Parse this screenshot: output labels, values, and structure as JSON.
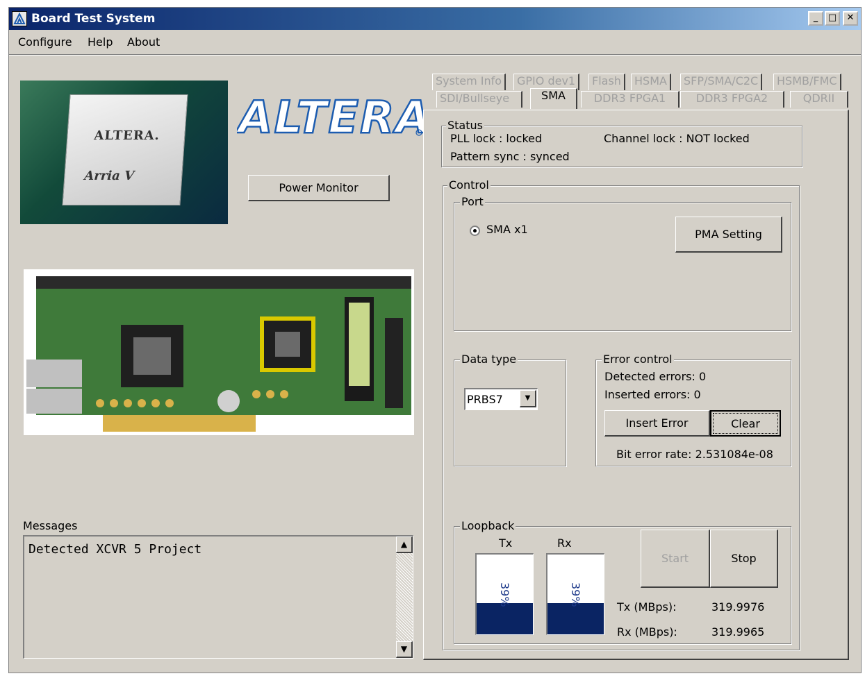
{
  "window": {
    "title": "Board Test System",
    "controls": {
      "minimize": "_",
      "maximize": "□",
      "close": "✕"
    }
  },
  "menu": {
    "items": [
      "Configure",
      "Help",
      "About"
    ]
  },
  "logo": {
    "brand": "ALTERA",
    "chip_brand": "ALTERA.",
    "chip_family": "Arria V"
  },
  "power_monitor_label": "Power Monitor",
  "messages": {
    "label": "Messages",
    "text": "Detected XCVR 5 Project"
  },
  "tabs": {
    "row1": [
      "System Info",
      "GPIO dev1",
      "Flash",
      "HSMA",
      "SFP/SMA/C2C",
      "HSMB/FMC"
    ],
    "row2": [
      "SDI/Bullseye",
      "SMA",
      "DDR3 FPGA1",
      "DDR3 FPGA2",
      "QDRII"
    ],
    "active": "SMA"
  },
  "status": {
    "title": "Status",
    "pll_lock": "PLL lock : locked",
    "channel_lock": "Channel lock : NOT locked",
    "pattern_sync": "Pattern sync : synced"
  },
  "control": {
    "title": "Control",
    "port": {
      "title": "Port",
      "option": "SMA x1",
      "selected": true,
      "pma_button": "PMA Setting"
    },
    "data_type": {
      "title": "Data type",
      "value": "PRBS7"
    },
    "error_control": {
      "title": "Error control",
      "detected": "Detected errors: 0",
      "inserted": "Inserted errors: 0",
      "insert_button": "Insert Error",
      "clear_button": "Clear",
      "bit_error_rate": "Bit error rate: 2.531084e-08"
    },
    "loopback": {
      "title": "Loopback",
      "tx_label": "Tx",
      "rx_label": "Rx",
      "tx_percent": 39,
      "rx_percent": 39,
      "tx_percent_text": "39%",
      "rx_percent_text": "39%",
      "start_button": "Start",
      "stop_button": "Stop",
      "tx_rate_label": "Tx (MBps):",
      "tx_rate_value": "319.9976",
      "rx_rate_label": "Rx (MBps):",
      "rx_rate_value": "319.9965"
    }
  },
  "colors": {
    "meter_fill": "#0a2463",
    "brand_blue": "#1c5cb0"
  }
}
